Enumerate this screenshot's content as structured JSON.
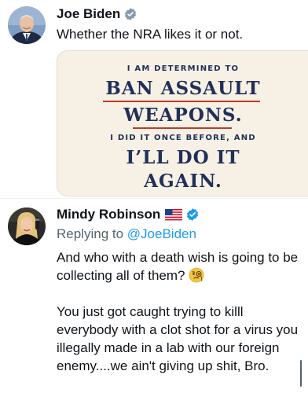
{
  "tweet1": {
    "author_name": "Joe Biden",
    "text": "Whether the NRA likes it or not.",
    "media": {
      "line1": "I AM DETERMINED TO",
      "line2": "BAN ASSAULT",
      "line3": "WEAPONS.",
      "line4": "I DID IT ONCE BEFORE, AND",
      "line5": "I’LL DO IT",
      "line6": "AGAIN."
    }
  },
  "tweet2": {
    "author_name": "Mindy Robinson",
    "replying_prefix": "Replying to ",
    "replying_handle": "@JoeBiden",
    "text_p1": "And who with a death wish is going to be collecting all of them?",
    "text_p2": "You just got caught trying to killl everybody with a clot shot for a virus you illegally made in a lab with our foreign enemy....we ain't giving up shit, Bro."
  },
  "colors": {
    "verified_blue": "#1d9bf0",
    "verified_gray": "#829aab",
    "link_blue": "#1d9bf0",
    "secondary_text": "#536471",
    "card_background": "#f7f1e5",
    "card_text": "#21305a",
    "card_underline": "#c0392b"
  },
  "icons": {
    "gov_badge": "gray-verified-badge-icon",
    "blue_badge": "blue-verified-badge-icon",
    "flag": "us-flag-icon",
    "emoji": "monocle-face-emoji-icon"
  }
}
